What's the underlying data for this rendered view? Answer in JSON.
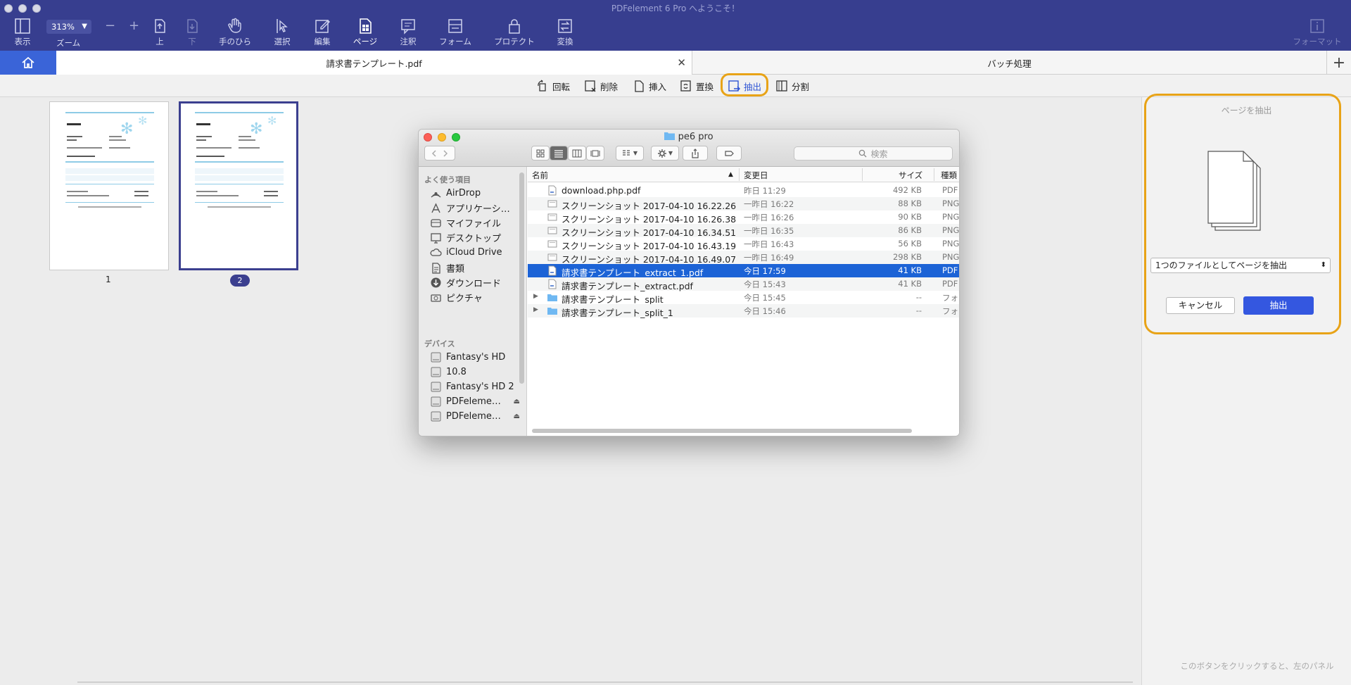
{
  "window": {
    "title": "PDFelement 6 Pro へようこそ！"
  },
  "toolbar": {
    "zoom_value": "313%",
    "zoom_minus": "−",
    "zoom_plus": "+",
    "view": "表示",
    "zoom": "ズーム",
    "up": "上",
    "down": "下",
    "hand": "手のひら",
    "select": "選択",
    "edit": "編集",
    "page": "ページ",
    "comment": "注釈",
    "form": "フォーム",
    "protect": "プロテクト",
    "convert": "変換",
    "format": "フォーマット"
  },
  "tabs": {
    "document": "請求書テンプレート.pdf",
    "batch": "バッチ処理",
    "close_glyph": "✕",
    "add_glyph": "+"
  },
  "page_tools": {
    "rotate": "回転",
    "delete": "削除",
    "insert": "挿入",
    "replace": "置換",
    "extract": "抽出",
    "split": "分割"
  },
  "thumbnails": [
    {
      "label": "1",
      "selected": false
    },
    {
      "label": "2",
      "selected": true
    }
  ],
  "finder": {
    "title": "pe6 pro",
    "search_placeholder": "検索",
    "sidebar": {
      "favorites_heading": "よく使う項目",
      "favorites": [
        {
          "label": "AirDrop",
          "icon": "airdrop-icon"
        },
        {
          "label": "アプリケーシ…",
          "icon": "applications-icon"
        },
        {
          "label": "マイファイル",
          "icon": "all-files-icon"
        },
        {
          "label": "デスクトップ",
          "icon": "desktop-icon"
        },
        {
          "label": "iCloud Drive",
          "icon": "cloud-icon"
        },
        {
          "label": "書類",
          "icon": "documents-icon"
        },
        {
          "label": "ダウンロード",
          "icon": "download-icon"
        },
        {
          "label": "ピクチャ",
          "icon": "camera-icon"
        }
      ],
      "devices_heading": "デバイス",
      "devices": [
        {
          "label": "Fantasy's HD",
          "eject": false
        },
        {
          "label": "10.8",
          "eject": false
        },
        {
          "label": "Fantasy's HD 2",
          "eject": false
        },
        {
          "label": "PDFeleme…",
          "eject": true
        },
        {
          "label": "PDFeleme…",
          "eject": true
        }
      ],
      "eject_glyph": "⏏"
    },
    "columns": {
      "name": "名前",
      "modified": "変更日",
      "size": "サイズ",
      "kind": "種類"
    },
    "files": [
      {
        "name": "download.php.pdf",
        "date": "昨日 11:29",
        "size": "492 KB",
        "kind": "PDF",
        "type": "pdf",
        "selected": false
      },
      {
        "name": "スクリーンショット 2017-04-10 16.22.26",
        "date": "一昨日 16:22",
        "size": "88 KB",
        "kind": "PNG",
        "type": "png",
        "selected": false
      },
      {
        "name": "スクリーンショット 2017-04-10 16.26.38",
        "date": "一昨日 16:26",
        "size": "90 KB",
        "kind": "PNG",
        "type": "png",
        "selected": false
      },
      {
        "name": "スクリーンショット 2017-04-10 16.34.51",
        "date": "一昨日 16:35",
        "size": "86 KB",
        "kind": "PNG",
        "type": "png",
        "selected": false
      },
      {
        "name": "スクリーンショット 2017-04-10 16.43.19",
        "date": "一昨日 16:43",
        "size": "56 KB",
        "kind": "PNG",
        "type": "png",
        "selected": false
      },
      {
        "name": "スクリーンショット 2017-04-10 16.49.07",
        "date": "一昨日 16:49",
        "size": "298 KB",
        "kind": "PNG",
        "type": "png",
        "selected": false
      },
      {
        "name": "請求書テンプレート_extract_1.pdf",
        "date": "今日 17:59",
        "size": "41 KB",
        "kind": "PDF",
        "type": "pdf",
        "selected": true
      },
      {
        "name": "請求書テンプレート_extract.pdf",
        "date": "今日 15:43",
        "size": "41 KB",
        "kind": "PDF",
        "type": "pdf",
        "selected": false
      },
      {
        "name": "請求書テンプレート_split",
        "date": "今日 15:45",
        "size": "--",
        "kind": "フォ",
        "type": "folder",
        "selected": false
      },
      {
        "name": "請求書テンプレート_split_1",
        "date": "今日 15:46",
        "size": "--",
        "kind": "フォ",
        "type": "folder",
        "selected": false
      }
    ]
  },
  "extract_panel": {
    "title": "ページを抽出",
    "mode": "1つのファイルとしてページを抽出",
    "cancel": "キャンセル",
    "extract": "抽出",
    "hint": "このボタンをクリックすると、左のパネル"
  },
  "colors": {
    "toolbar": "#373e8f",
    "accent": "#3457e0",
    "highlight": "#e8a317",
    "selection": "#1c63d6"
  }
}
